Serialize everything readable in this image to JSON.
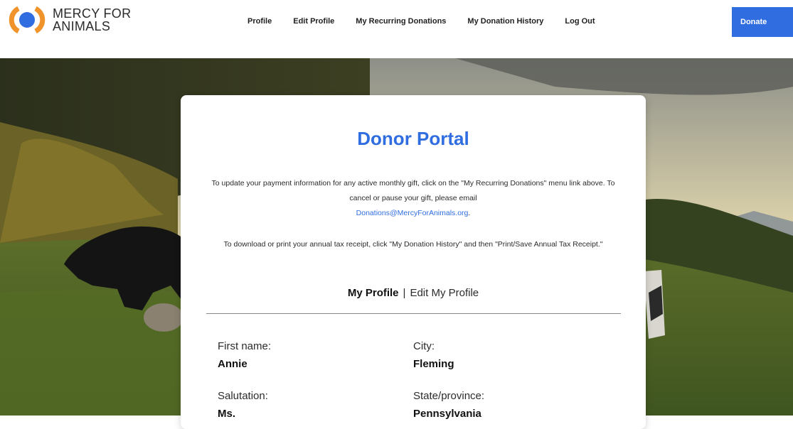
{
  "header": {
    "logo_line1": "MERCY FOR",
    "logo_line2": "ANIMALS",
    "nav": [
      {
        "label": "Profile"
      },
      {
        "label": "Edit Profile"
      },
      {
        "label": "My Recurring Donations"
      },
      {
        "label": "My Donation History"
      },
      {
        "label": "Log Out"
      }
    ],
    "donate_label": "Donate"
  },
  "card": {
    "title": "Donor Portal",
    "intro_part1": "To update your payment information for any active monthly gift, click on the \"My Recurring Donations\" menu link above. To cancel or pause your gift, please email",
    "intro_email": "Donations@MercyForAnimals.org",
    "intro_part2": ".",
    "tax_text": "To download or print your annual tax receipt, click \"My Donation History\" and then \"Print/Save Annual Tax Receipt.\"",
    "tab_active": "My Profile",
    "tab_separator": "|",
    "tab_other": "Edit My Profile",
    "fields": [
      {
        "label": "First name:",
        "value": "Annie"
      },
      {
        "label": "City:",
        "value": "Fleming"
      },
      {
        "label": "Salutation:",
        "value": "Ms."
      },
      {
        "label": "State/province:",
        "value": "Pennsylvania"
      }
    ]
  },
  "colors": {
    "brand_blue": "#2f6de1",
    "logo_orange": "#f0932b"
  }
}
